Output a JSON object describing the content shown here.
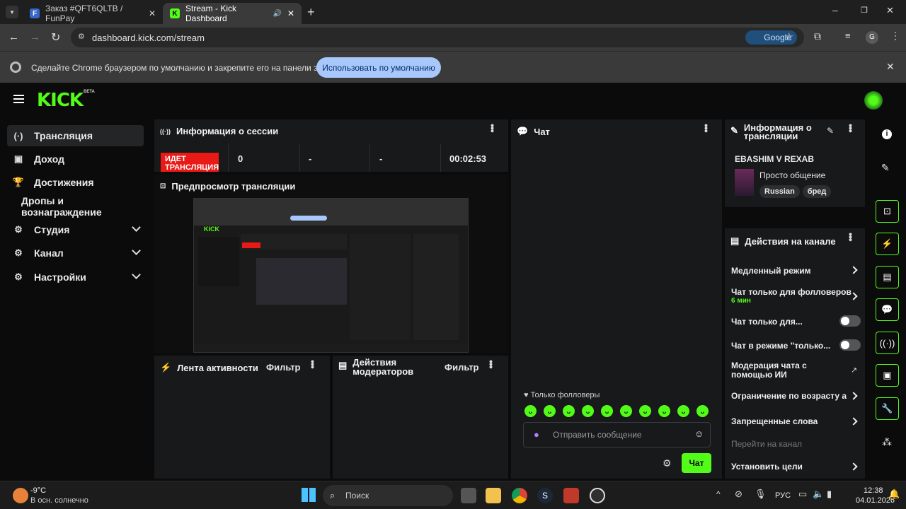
{
  "browser": {
    "tabs": [
      {
        "title": "Заказ #QFT6QLTB / FunPay",
        "favicon": "F"
      },
      {
        "title": "Stream - Kick Dashboard",
        "favicon": "K"
      }
    ],
    "url": "dashboard.kick.com/stream",
    "google_label": "Google",
    "profile_initial": "G",
    "infobar_text": "Сделайте Chrome браузером по умолчанию и закрепите его на панели задач.",
    "infobar_button": "Использовать по умолчанию"
  },
  "app": {
    "logo": "KICK",
    "beta": "BETA",
    "nav": [
      {
        "label": "Трансляция",
        "icon": "(·)",
        "active": true
      },
      {
        "label": "Доход",
        "icon": "▣"
      },
      {
        "label": "Достижения",
        "icon": "🏆"
      },
      {
        "label": "Дропы и вознаграждение"
      },
      {
        "label": "Студия",
        "icon": "⚙"
      },
      {
        "label": "Канал",
        "icon": "⚙"
      },
      {
        "label": "Настройки",
        "icon": "⚙"
      }
    ]
  },
  "session": {
    "title": "Информация о сессии",
    "live_badge": "ИДЕТ ТРАНСЛЯЦИЯ",
    "stats": [
      "0",
      "-",
      "-",
      "00:02:53"
    ]
  },
  "preview": {
    "title": "Предпросмотр трансляции"
  },
  "activity": {
    "title": "Лента активности",
    "filter": "Фильтр"
  },
  "modactions": {
    "title": "Действия модераторов",
    "filter": "Фильтр"
  },
  "chat": {
    "title": "Чат",
    "followers_only": "Только фолловеры",
    "placeholder": "Отправить сообщение",
    "send": "Чат"
  },
  "stream_info": {
    "title": "Информация о трансляции",
    "stream_title": "EBASHIM V REXAB",
    "category": "Просто общение",
    "tags": [
      "Russian",
      "бред"
    ]
  },
  "channel_actions": {
    "title": "Действия на канале",
    "items": [
      {
        "label": "Медленный режим",
        "type": "arrow"
      },
      {
        "label": "Чат только для фолловеров",
        "sub": "6 мин",
        "type": "arrow"
      },
      {
        "label": "Чат только для...",
        "type": "toggle"
      },
      {
        "label": "Чат в режиме \"только...",
        "type": "toggle"
      },
      {
        "label": "Модерация чата с помощью ИИ",
        "type": "external"
      },
      {
        "label": "Ограничение по возрасту ау",
        "type": "arrow"
      },
      {
        "label": "Запрещенные слова",
        "type": "arrow"
      },
      {
        "label": "Перейти на канал",
        "type": "disabled"
      },
      {
        "label": "Установить цели",
        "type": "arrow"
      }
    ]
  },
  "taskbar": {
    "weather_temp": "-9°C",
    "weather_desc": "В осн. солнечно",
    "search": "Поиск",
    "lang": "РУС",
    "time": "12:38",
    "date": "04.01.2026"
  },
  "colors": {
    "accent": "#53fc18",
    "live": "#e91916"
  }
}
